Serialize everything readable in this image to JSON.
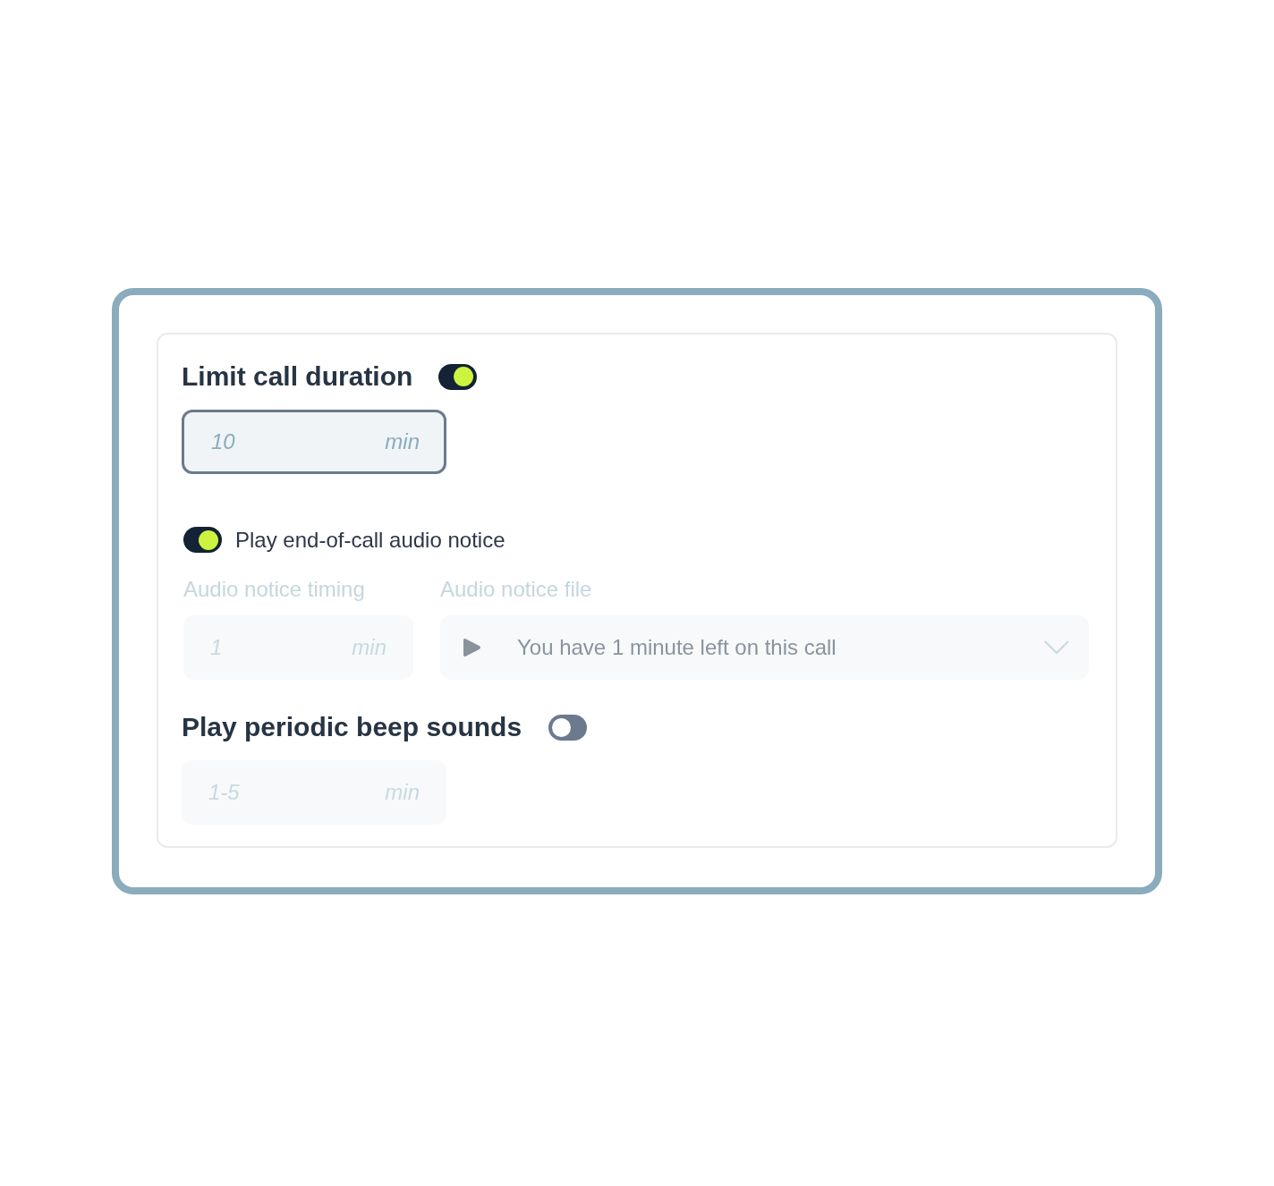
{
  "limit_call_duration": {
    "title": "Limit call duration",
    "on": true,
    "field": {
      "placeholder": "10",
      "unit": "min",
      "disabled": false
    }
  },
  "audio_notice": {
    "label": "Play end-of-call audio notice",
    "on": true,
    "timing": {
      "label": "Audio notice timing",
      "placeholder": "1",
      "unit": "min",
      "disabled": true
    },
    "file": {
      "label": "Audio notice file",
      "value": "You have 1 minute left on this call",
      "disabled": true
    }
  },
  "periodic_beep": {
    "title": "Play periodic beep sounds",
    "on": false,
    "field": {
      "placeholder": "1-5",
      "unit": "min",
      "disabled": true
    }
  }
}
